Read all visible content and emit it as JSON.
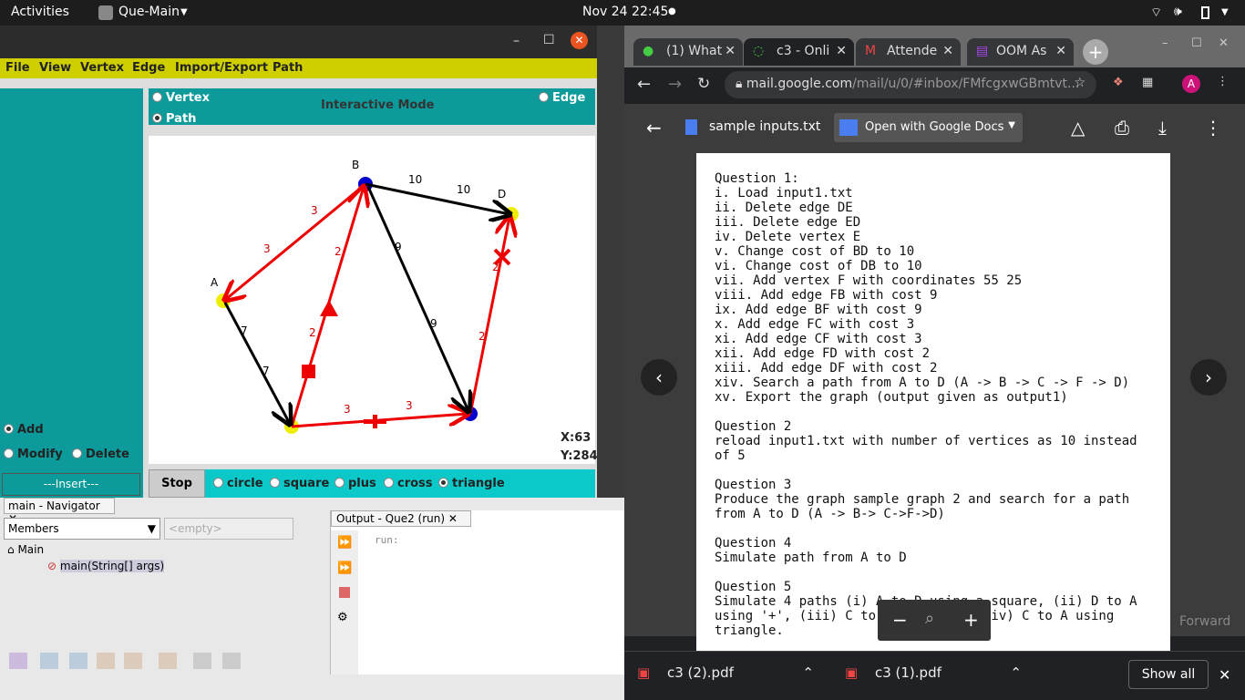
{
  "topbar": {
    "activities": "Activities",
    "app": "Que-Main",
    "datetime": "Nov 24  22:45"
  },
  "java": {
    "menu": [
      "File",
      "View",
      "Vertex",
      "Edge",
      "Import/Export",
      "Path"
    ],
    "mode_vertex": "Vertex",
    "mode_path": "Path",
    "mode_edge": "Edge",
    "mode_title": "Interactive Mode",
    "left": {
      "add": "Add",
      "modify": "Modify",
      "delete": "Delete",
      "insert": "---Insert---"
    },
    "coords": {
      "x": "X:63",
      "y": "Y:284"
    },
    "bottom": {
      "stop": "Stop",
      "circle": "circle",
      "square": "square",
      "plus": "plus",
      "cross": "cross",
      "triangle": "triangle"
    },
    "vertex_labels": {
      "A": "A",
      "B": "B",
      "D": "D"
    },
    "edge_labels": [
      "3",
      "3",
      "2",
      "2",
      "10",
      "10",
      "9",
      "9",
      "2",
      "2",
      "7",
      "7",
      "3",
      "3"
    ]
  },
  "netbeans": {
    "nav_title": "main - Navigator",
    "members": "Members",
    "empty": "<empty>",
    "tree_main": "Main",
    "tree_method": "main(String[] args)",
    "output_title": "Output - Que2 (run)",
    "run": "run:"
  },
  "chrome": {
    "tabs": [
      "(1) What",
      "c3 - Onli",
      "Attende",
      "OOM As"
    ],
    "url_host": "mail.google.com",
    "url_path": "/mail/u/0/#inbox/FMfcgxwGBmtvt...",
    "file_name": "sample inputs.txt",
    "open_with": "Open with Google Docs",
    "doc_text": "Question 1:\ni. Load input1.txt\nii. Delete edge DE\niii. Delete edge ED\niv. Delete vertex E\nv. Change cost of BD to 10\nvi. Change cost of DB to 10\nvii. Add vertex F with coordinates 55 25\nviii. Add edge FB with cost 9\nix. Add edge BF with cost 9\nx. Add edge FC with cost 3\nxi. Add edge CF with cost 3\nxii. Add edge FD with cost 2\nxiii. Add edge DF with cost 2\nxiv. Search a path from A to D (A -> B -> C -> F -> D)\nxv. Export the graph (output given as output1)\n\nQuestion 2\nreload input1.txt with number of vertices as 10 instead\nof 5\n\nQuestion 3\nProduce the graph sample graph 2 and search for a path\nfrom A to D (A -> B-> C->F->D)\n\nQuestion 4\nSimulate path from A to D\n\nQuestion 5\nSimulate 4 paths (i) A to D using a square, (ii) D to A\nusing '+', (iii) C to D using 'X', (iv) C to A using\ntriangle.",
    "downloads": [
      "c3 (2).pdf",
      "c3 (1).pdf"
    ],
    "show_all": "Show all",
    "forward": "Forward"
  }
}
